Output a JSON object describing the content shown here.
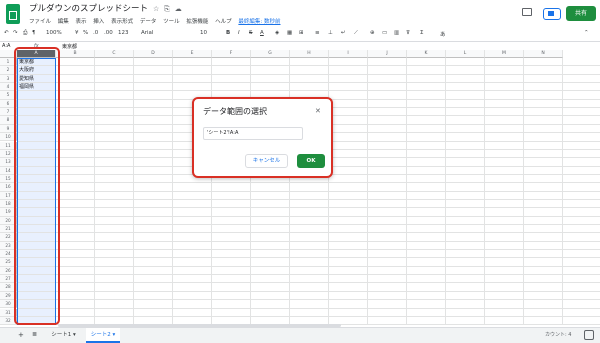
{
  "app": {
    "title": "プルダウンのスプレッドシート",
    "title_icons": [
      "star-icon",
      "move-icon",
      "cloud-icon"
    ],
    "menu": [
      "ファイル",
      "編集",
      "表示",
      "挿入",
      "表示形式",
      "データ",
      "ツール",
      "拡張機能",
      "ヘルプ"
    ],
    "last_edit": "最終編集: 数秒前",
    "share_label": "共有"
  },
  "toolbar": {
    "zoom": "100%",
    "currency": "¥",
    "percent": "%",
    "dec_decrease": ".0",
    "dec_increase": ".00",
    "format_more": "123",
    "font": "Arial",
    "font_size": "10",
    "bold": "B",
    "italic": "I",
    "strike": "S",
    "text_color": "A",
    "input_tools": "あ"
  },
  "formula_bar": {
    "name_box": "A:A",
    "fx": "fx",
    "value": "東京都"
  },
  "grid": {
    "columns": [
      "A",
      "B",
      "C",
      "D",
      "E",
      "F",
      "G",
      "H",
      "I",
      "J",
      "K",
      "L",
      "M",
      "N"
    ],
    "rows": [
      "1",
      "2",
      "3",
      "4",
      "5",
      "6",
      "7",
      "8",
      "9",
      "10",
      "11",
      "12",
      "13",
      "14",
      "15",
      "16",
      "17",
      "18",
      "19",
      "20",
      "21",
      "22",
      "23",
      "24",
      "25",
      "26",
      "27",
      "28",
      "29",
      "30",
      "31",
      "32"
    ],
    "colA_values": [
      "東京都",
      "大阪府",
      "愛知県",
      "福岡県"
    ]
  },
  "modal": {
    "title": "データ範囲の選択",
    "range_value": "'シート2'!A:A",
    "cancel_label": "キャンセル",
    "ok_label": "OK"
  },
  "sheets": {
    "tabs": [
      "シート1 ▾",
      "シート2 ▾"
    ],
    "active": 1,
    "count_label": "カウント: 4"
  },
  "colors": {
    "accent": "#1a73e8",
    "share_green": "#1e8e3e",
    "annotation_red": "#d93025",
    "selection_fill": "#e8f0fe"
  }
}
